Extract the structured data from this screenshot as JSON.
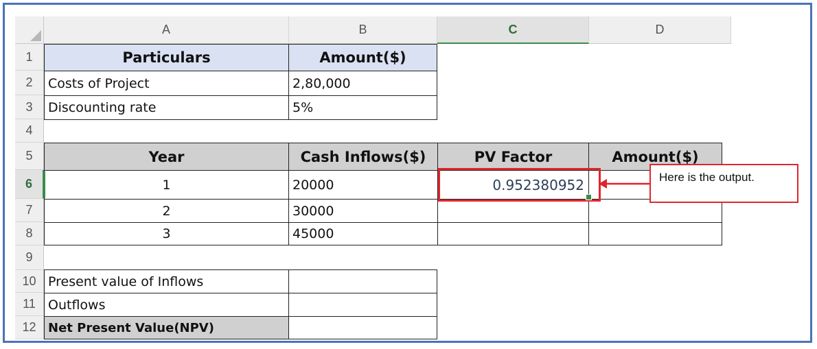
{
  "columns": [
    "A",
    "B",
    "C",
    "D"
  ],
  "rows": [
    "1",
    "2",
    "3",
    "4",
    "5",
    "6",
    "7",
    "8",
    "9",
    "10",
    "11",
    "12"
  ],
  "selected_column": "C",
  "selected_row": "6",
  "table1": {
    "header_particulars": "Particulars",
    "header_amount": "Amount($)",
    "cost_label": "Costs of Project",
    "cost_value": "2,80,000",
    "rate_label": "Discounting rate",
    "rate_value": "5%"
  },
  "table2": {
    "header_year": "Year",
    "header_inflows": "Cash Inflows($)",
    "header_pv": "PV Factor",
    "header_amount": "Amount($)",
    "rows": [
      {
        "year": "1",
        "inflow": "20000",
        "pv": "0.952380952"
      },
      {
        "year": "2",
        "inflow": "30000",
        "pv": ""
      },
      {
        "year": "3",
        "inflow": "45000",
        "pv": ""
      }
    ]
  },
  "summary": {
    "pv_inflows_label": "Present value of Inflows",
    "outflows_label": "Outflows",
    "npv_label": "Net Present Value(NPV)"
  },
  "callout_text": "Here is  the output.",
  "accent_color": "#e0262d",
  "frame_color": "#4a72b8"
}
